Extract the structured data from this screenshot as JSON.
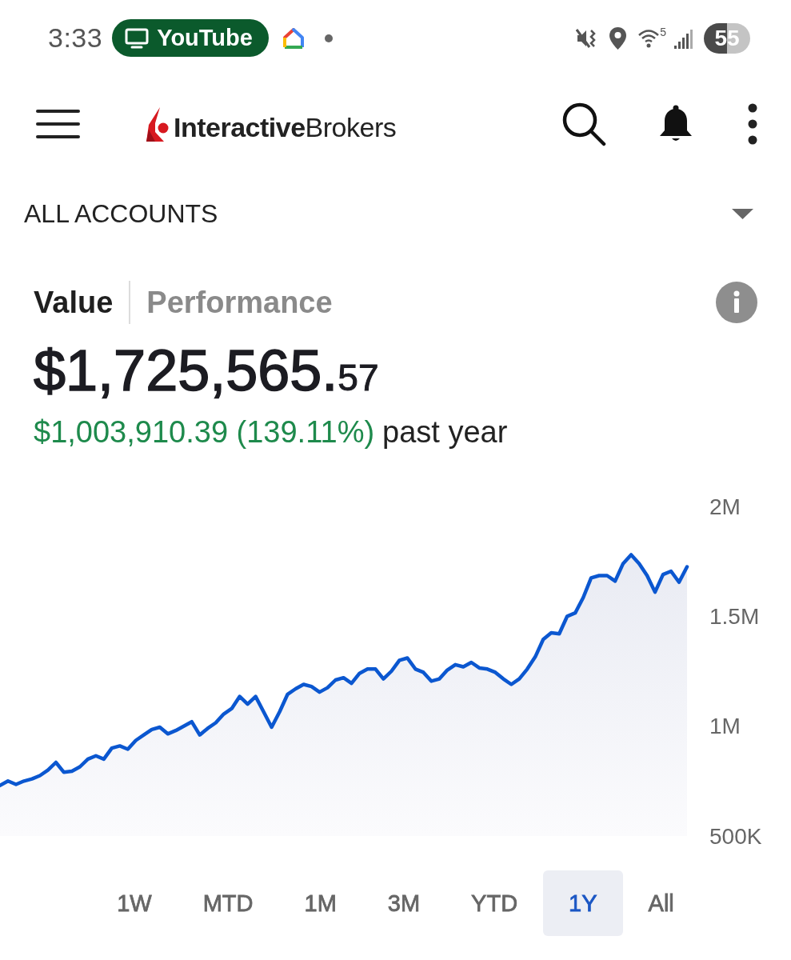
{
  "status_bar": {
    "time": "3:33",
    "app_chip": "YouTube",
    "wifi_band": "5",
    "battery": "55"
  },
  "app_bar": {
    "logo": "**Interactive**Brokers"
  },
  "account_selector": {
    "label": "ALL ACCOUNTS"
  },
  "view_tabs": [
    {
      "label": "Value",
      "selected": true
    },
    {
      "label": "Performance",
      "selected": false
    }
  ],
  "summary": {
    "value": "$1,725,565.",
    "value_cents": "57",
    "change": "$1,003,910.39 (139.11%)",
    "positive": true,
    "change_period": "past year"
  },
  "chart": {
    "chart_data": {
      "type": "area",
      "ylim": [
        500000,
        2000000
      ],
      "yticks": [
        {
          "value": 500000,
          "label": "500K"
        },
        {
          "value": 1000000,
          "label": "1M"
        },
        {
          "value": 1500000,
          "label": "1.5M"
        },
        {
          "value": 2000000,
          "label": "2M"
        }
      ],
      "series": [
        {
          "color": "#0b57d0",
          "values": [
            730000,
            750000,
            735000,
            750000,
            760000,
            775000,
            800000,
            835000,
            790000,
            795000,
            815000,
            850000,
            865000,
            850000,
            900000,
            910000,
            895000,
            935000,
            960000,
            985000,
            995000,
            965000,
            980000,
            1000000,
            1020000,
            960000,
            990000,
            1015000,
            1055000,
            1080000,
            1135000,
            1100000,
            1135000,
            1065000,
            995000,
            1065000,
            1145000,
            1170000,
            1190000,
            1180000,
            1155000,
            1175000,
            1210000,
            1220000,
            1195000,
            1240000,
            1260000,
            1260000,
            1215000,
            1250000,
            1300000,
            1310000,
            1260000,
            1245000,
            1205000,
            1215000,
            1255000,
            1280000,
            1270000,
            1290000,
            1265000,
            1260000,
            1245000,
            1215000,
            1190000,
            1215000,
            1260000,
            1315000,
            1395000,
            1425000,
            1420000,
            1500000,
            1515000,
            1585000,
            1675000,
            1685000,
            1685000,
            1660000,
            1740000,
            1780000,
            1740000,
            1685000,
            1610000,
            1690000,
            1705000,
            1655000,
            1725000
          ]
        }
      ]
    }
  },
  "range_tabs": [
    {
      "label": "1W",
      "selected": false
    },
    {
      "label": "MTD",
      "selected": false
    },
    {
      "label": "1M",
      "selected": false
    },
    {
      "label": "3M",
      "selected": false
    },
    {
      "label": "YTD",
      "selected": false
    },
    {
      "label": "1Y",
      "selected": true
    },
    {
      "label": "All",
      "selected": false
    }
  ]
}
